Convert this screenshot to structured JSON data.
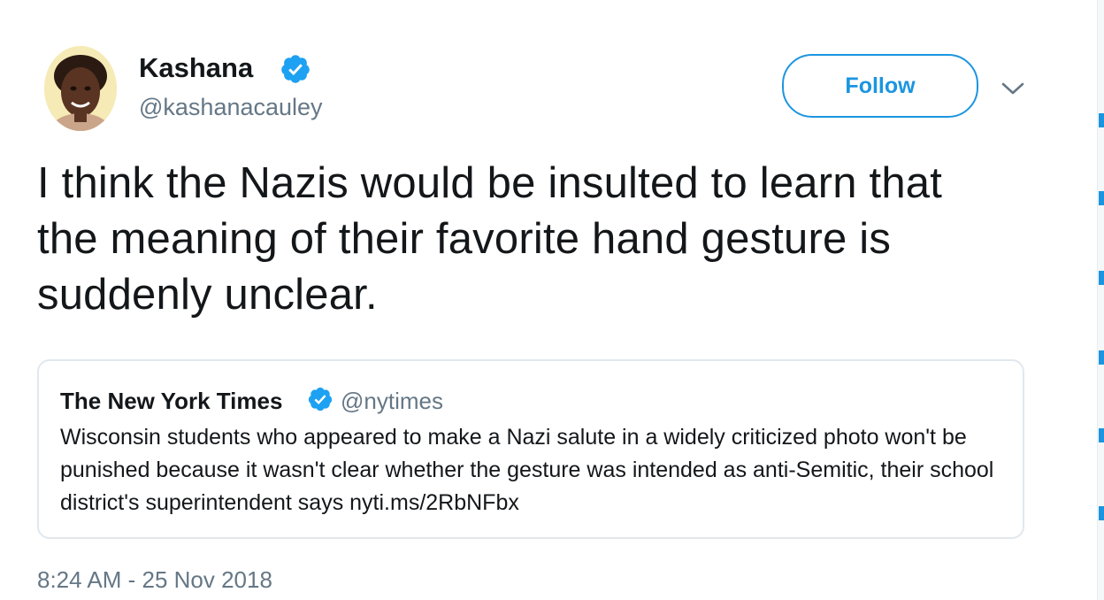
{
  "colors": {
    "accent": "#1b95e0",
    "text_primary": "#14171a",
    "text_secondary": "#657786",
    "border": "#e1e8ed",
    "verified": "#1da1f2"
  },
  "author": {
    "display_name": "Kashana",
    "handle": "@kashanacauley",
    "verified_icon": "verified-badge-icon"
  },
  "actions": {
    "follow_label": "Follow",
    "more_icon": "chevron-down-icon"
  },
  "tweet": {
    "text": "I think the Nazis would be insulted to learn that the meaning of their favorite hand gesture is suddenly unclear.",
    "timestamp": "8:24 AM - 25 Nov 2018"
  },
  "quoted_tweet": {
    "author_name": "The New York Times",
    "author_handle": "@nytimes",
    "verified_icon": "verified-badge-icon",
    "text": "Wisconsin students who appeared to make a Nazi salute in a widely criticized photo won't be punished because it wasn't clear whether the gesture was intended as anti-Semitic, their school district's superintendent says nyti.ms/2RbNFbx"
  }
}
